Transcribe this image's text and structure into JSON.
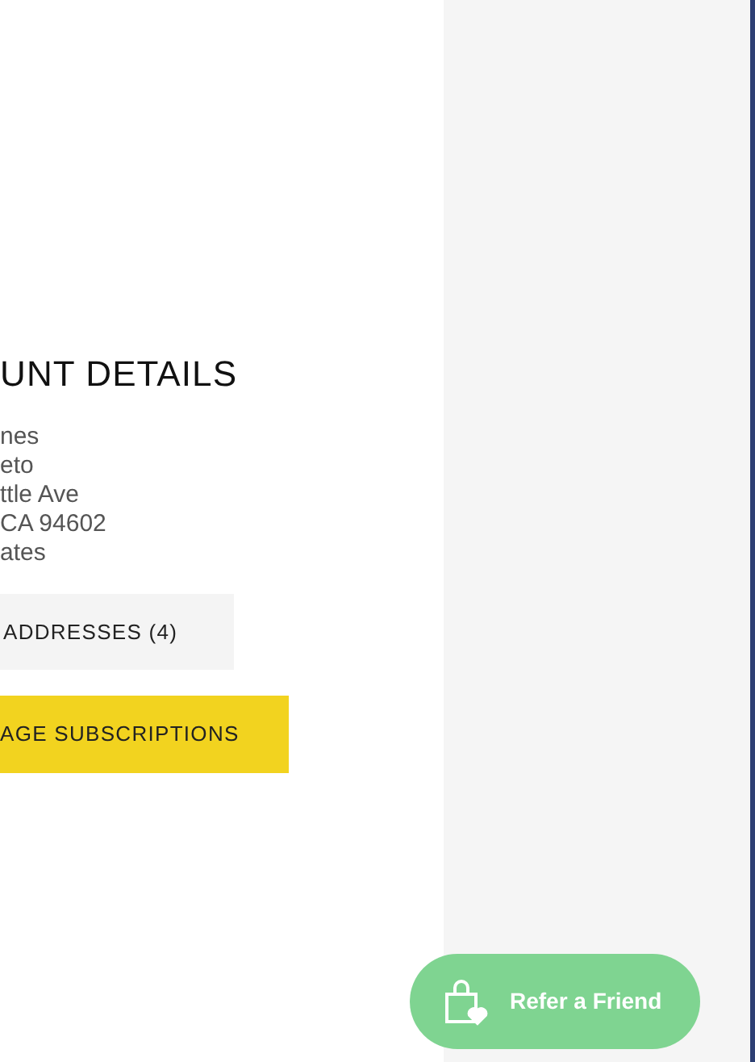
{
  "account": {
    "heading": "UNT DETAILS",
    "address_lines": [
      "nes",
      "eto",
      "ttle Ave",
      "CA 94602",
      "ates"
    ],
    "addresses_button": "ADDRESSES (4)",
    "subscriptions_button": "AGE SUBSCRIPTIONS"
  },
  "refer_button": {
    "label": "Refer a Friend"
  }
}
